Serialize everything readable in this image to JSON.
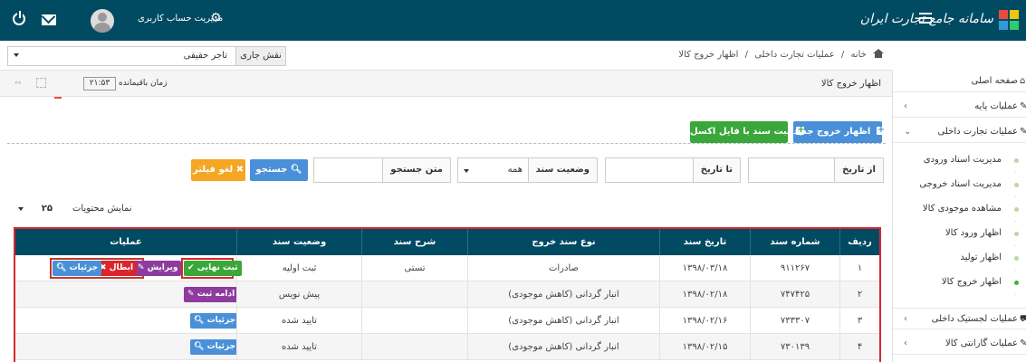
{
  "app": {
    "title": "سامانه جامع تجارت ایران",
    "account_link": "مدیریت حساب کاربری"
  },
  "role": {
    "label": "نقش جاری",
    "value": "تاجر حقیقی"
  },
  "breadcrumb": {
    "home": "خانه",
    "sep1": "/",
    "level2": "عملیات تجارت داخلی",
    "sep2": "/",
    "current": "اظهار خروج کالا"
  },
  "panel": {
    "title": "اظهار خروج کالا",
    "timer_label": "زمان باقیمانده",
    "timer_value": "۲۱:۵۳"
  },
  "sidebar": {
    "items": [
      {
        "label": "صفحه اصلی",
        "icon": "home-icon"
      },
      {
        "label": "عملیات پایه",
        "icon": "edit-icon"
      },
      {
        "label": "عملیات تجارت داخلی",
        "icon": "edit-icon"
      }
    ],
    "sub_items": [
      {
        "label": "مدیریت اسناد ورودی"
      },
      {
        "label": "مدیریت اسناد خروجی"
      },
      {
        "label": "مشاهده موجودی کالا"
      },
      {
        "label": "اظهار ورود کالا"
      },
      {
        "label": "اظهار تولید"
      },
      {
        "label": "اظهار خروج کالا"
      }
    ],
    "bottom_items": [
      {
        "label": "عملیات لجستیک داخلی",
        "icon": "truck-icon"
      },
      {
        "label": "عملیات گارانتی کالا",
        "icon": "edit-icon"
      }
    ]
  },
  "toolbar": {
    "new_label": "اظهار خروج جدید",
    "excel_label": "ثبت سند با فایل اکسل"
  },
  "filters": {
    "from_date_label": "از تاریخ",
    "to_date_label": "تا تاریخ",
    "status_label": "وضعیت سند",
    "status_value": "همه",
    "search_label": "متن جستجو",
    "search_button": "جستجو",
    "clear_button": "لغو فیلتر"
  },
  "paging": {
    "label": "نمایش محتویات",
    "value": "۲۵"
  },
  "table": {
    "headers": {
      "row": "ردیف",
      "number": "شماره سند",
      "date": "تاریخ سند",
      "type": "نوع سند خروج",
      "desc": "شرح سند",
      "status": "وضعیت سند",
      "actions": "عملیات"
    },
    "rows": [
      {
        "row": "۱",
        "number": "۹۱۱۲۶۷",
        "date": "۱۳۹۸/۰۳/۱۸",
        "type": "صادرات",
        "desc": "تستی",
        "status": "ثبت اولیه"
      },
      {
        "row": "۲",
        "number": "۷۴۷۴۲۵",
        "date": "۱۳۹۸/۰۲/۱۸",
        "type": "انبار گردانی (کاهش موجودی)",
        "desc": "",
        "status": "پیش نویس"
      },
      {
        "row": "۳",
        "number": "۷۳۳۳۰۷",
        "date": "۱۳۹۸/۰۲/۱۶",
        "type": "انبار گردانی (کاهش موجودی)",
        "desc": "",
        "status": "تایید شده"
      },
      {
        "row": "۴",
        "number": "۷۳۰۱۳۹",
        "date": "۱۳۹۸/۰۲/۱۵",
        "type": "انبار گردانی (کاهش موجودی)",
        "desc": "",
        "status": "تایید شده"
      }
    ],
    "actions": {
      "final": "ثبت نهایی",
      "edit": "ویرایش",
      "cancel": "ابطال",
      "details": "جزئیات",
      "continue": "ادامه ثبت"
    }
  },
  "colors": {
    "header_bg": "#004a62",
    "accent_red": "#d8262c",
    "blue": "#4a90d9",
    "green": "#3aa73a",
    "orange": "#f5a623",
    "purple": "#8e3b9e"
  }
}
